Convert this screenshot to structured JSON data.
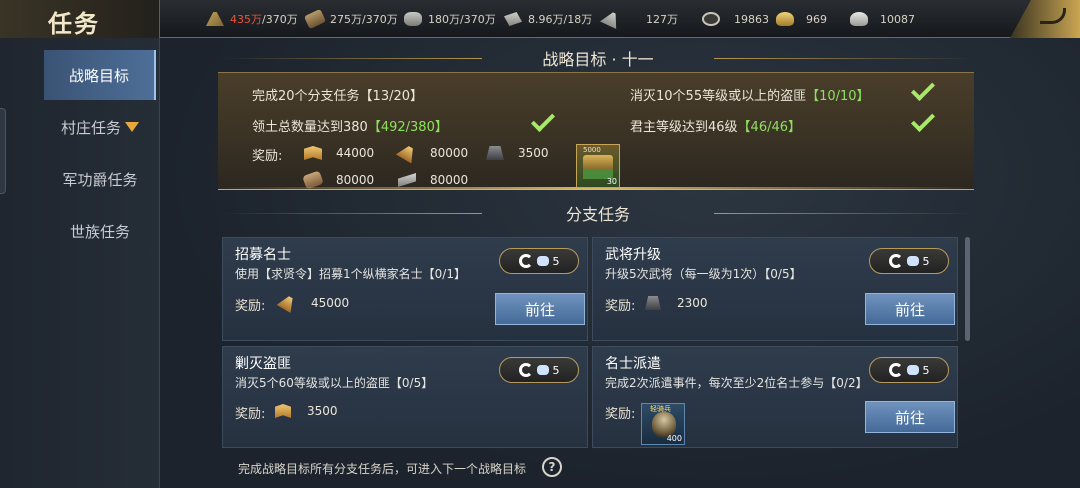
{
  "header": {
    "title": "任务",
    "resources": [
      {
        "icon": "wheat-icon",
        "current": "435万",
        "cap": "/370万",
        "over": true
      },
      {
        "icon": "wood-icon",
        "current": "275万",
        "cap": "/370万",
        "over": false
      },
      {
        "icon": "stone-icon",
        "current": "180万",
        "cap": "/370万",
        "over": false
      },
      {
        "icon": "iron-icon",
        "current": "8.96万",
        "cap": "/18万",
        "over": false
      },
      {
        "icon": "feather-icon",
        "current": "127万",
        "cap": "",
        "over": false
      },
      {
        "icon": "copper-coin-icon",
        "current": "19863",
        "cap": "",
        "over": false
      },
      {
        "icon": "gold-ingot-icon",
        "current": "969",
        "cap": "",
        "over": false
      },
      {
        "icon": "silver-ingot-icon",
        "current": "10087",
        "cap": "",
        "over": false
      }
    ]
  },
  "sidebar": {
    "items": [
      {
        "label": "战略目标",
        "active": true
      },
      {
        "label": "村庄任务",
        "active": false
      },
      {
        "label": "军功爵任务",
        "active": false
      },
      {
        "label": "世族任务",
        "active": false
      }
    ]
  },
  "strategy": {
    "title": "战略目标 · 十一",
    "objectives": [
      {
        "text": "完成20个分支任务",
        "progress": "【13/20】",
        "done": false
      },
      {
        "text": "消灭10个55等级或以上的盗匪",
        "progress": "【10/10】",
        "done": true
      },
      {
        "text": "领土总数量达到380",
        "progress": "【492/380】",
        "done": true
      },
      {
        "text": "君主等级达到46级",
        "progress": "【46/46】",
        "done": true
      }
    ],
    "reward_label": "奖励:",
    "rewards": [
      {
        "icon": "book-reward-icon",
        "amount": "44000"
      },
      {
        "icon": "feather-reward-icon",
        "amount": "80000"
      },
      {
        "icon": "iron-reward-icon",
        "amount": "3500"
      },
      {
        "icon": "wood-reward-icon",
        "amount": "80000"
      },
      {
        "icon": "gear-reward-icon",
        "amount": "80000"
      }
    ],
    "chest": {
      "label": "5000",
      "count": "30"
    }
  },
  "branch": {
    "title": "分支任务",
    "tasks": [
      {
        "title": "招募名士",
        "desc": "使用【求贤令】招募1个纵横家名士【0/1】",
        "refresh": "5",
        "reward_label": "奖励:",
        "reward_icon": "feather-reward-icon",
        "reward": "45000",
        "go": "前往"
      },
      {
        "title": "武将升级",
        "desc": "升级5次武将（每一级为1次）【0/5】",
        "refresh": "5",
        "reward_label": "奖励:",
        "reward_icon": "iron-reward-icon",
        "reward": "2300",
        "go": "前往"
      },
      {
        "title": "剿灭盗匪",
        "desc": "消灭5个60等级或以上的盗匪【0/5】",
        "refresh": "5",
        "reward_label": "奖励:",
        "reward_icon": "book-reward-icon",
        "reward": "3500",
        "go": ""
      },
      {
        "title": "名士派遣",
        "desc": "完成2次派遣事件，每次至少2位名士参与【0/2】",
        "refresh": "5",
        "reward_label": "奖励:",
        "reward_icon": "item-reward-icon",
        "reward_item": {
          "label": "轻骑兵",
          "count": "400"
        },
        "go": "前往"
      }
    ]
  },
  "footer": {
    "text": "完成战略目标所有分支任务后，可进入下一个战略目标",
    "help": "?"
  }
}
